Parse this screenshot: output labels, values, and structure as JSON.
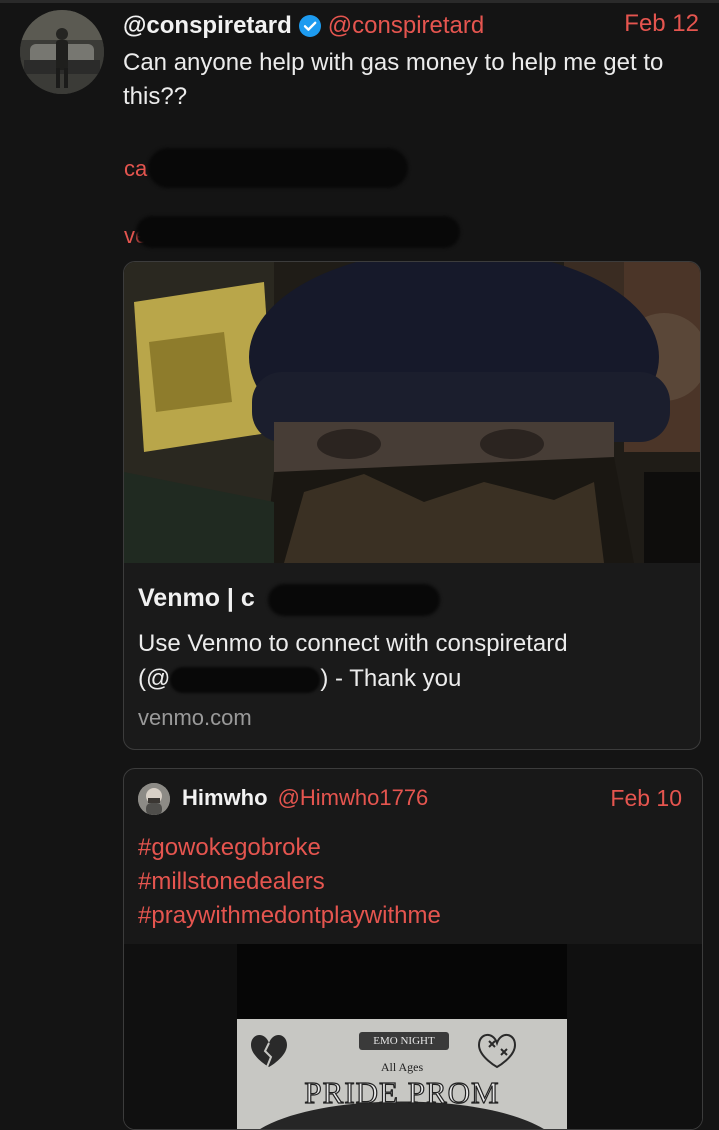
{
  "post": {
    "display_name": "@conspiretard",
    "handle": "@conspiretard",
    "date": "Feb 12",
    "text": "Can anyone help with gas money to help me get to this??",
    "redacted_line_1_visible": "ca",
    "redacted_line_2_visible": "ve",
    "verified_icon": "verified-badge-icon"
  },
  "link_card": {
    "title": "Venmo | c",
    "description_line_1": "Use Venmo to connect with conspiretard",
    "description_line_2_prefix": "(@",
    "description_line_2_suffix": ") - Thank you",
    "domain": "venmo.com"
  },
  "quoted_post": {
    "display_name": "Himwho",
    "handle": "@Himwho1776",
    "date": "Feb 10",
    "hashtags": [
      "#gowokegobroke",
      "#millstonedealers",
      "#praywithmedontplaywithme"
    ],
    "poster": {
      "badge": "EMO NIGHT",
      "subtitle": "All Ages",
      "headline": "PRIDE PROM"
    }
  },
  "colors": {
    "background": "#141414",
    "accent": "#e5554f",
    "text": "#ececec",
    "muted": "#9a9a9a",
    "border": "#3c3c3c",
    "verified": "#1d9bf0"
  }
}
